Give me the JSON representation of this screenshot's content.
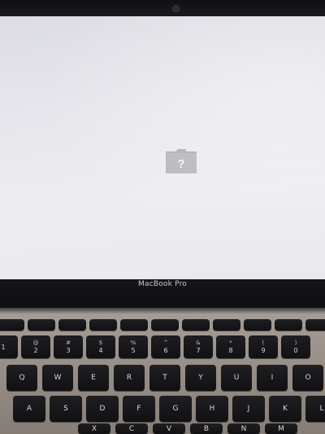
{
  "laptop": {
    "brand_label": "MacBook Pro"
  },
  "screen": {
    "icon": "folder-question-icon",
    "icon_symbol": "?",
    "background": "#e8e8ed"
  },
  "keyboard": {
    "row_function": [
      "",
      "",
      "",
      "",
      "",
      "",
      "",
      "",
      "",
      "",
      "",
      ""
    ],
    "row_numbers": [
      {
        "top": "",
        "bottom": "1"
      },
      {
        "top": "@",
        "bottom": "2"
      },
      {
        "top": "#",
        "bottom": "3"
      },
      {
        "top": "$",
        "bottom": "4"
      },
      {
        "top": "%",
        "bottom": "5"
      },
      {
        "top": "^",
        "bottom": "6"
      },
      {
        "top": "&",
        "bottom": "7"
      },
      {
        "top": "*",
        "bottom": "8"
      },
      {
        "top": "(",
        "bottom": "9"
      },
      {
        "top": ")",
        "bottom": "0"
      }
    ],
    "row_qwerty": [
      "Q",
      "W",
      "E",
      "R",
      "T",
      "Y",
      "U",
      "I",
      "O"
    ],
    "row_asdf": [
      "A",
      "S",
      "D",
      "F",
      "G",
      "H",
      "J",
      "K",
      "L"
    ],
    "row_zxcv": [
      "X",
      "C",
      "V",
      "B",
      "N",
      "M"
    ]
  }
}
